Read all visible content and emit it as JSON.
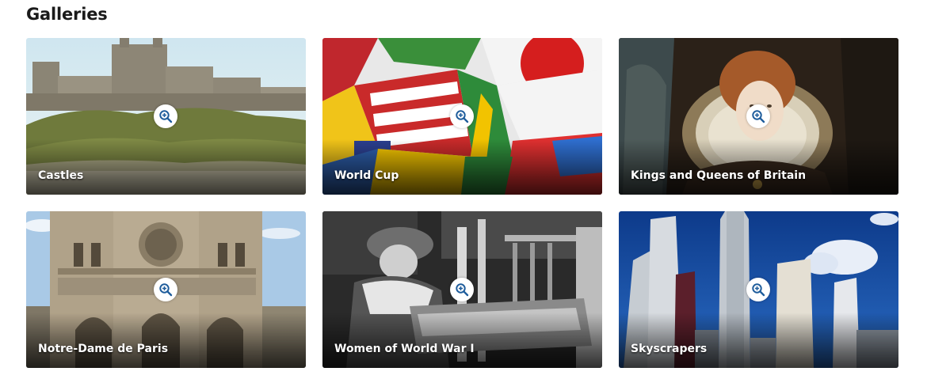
{
  "page": {
    "heading": "Galleries"
  },
  "colors": {
    "accent": "#1f5d9c",
    "label_text": "#ffffff",
    "heading_text": "#1a1a1a"
  },
  "galleries": [
    {
      "label": "Castles",
      "icon": "magnifier-plus-icon"
    },
    {
      "label": "World Cup",
      "icon": "magnifier-plus-icon"
    },
    {
      "label": "Kings and Queens of Britain",
      "icon": "magnifier-plus-icon"
    },
    {
      "label": "Notre-Dame de Paris",
      "icon": "magnifier-plus-icon"
    },
    {
      "label": "Women of World War I",
      "icon": "magnifier-plus-icon"
    },
    {
      "label": "Skyscrapers",
      "icon": "magnifier-plus-icon"
    }
  ]
}
